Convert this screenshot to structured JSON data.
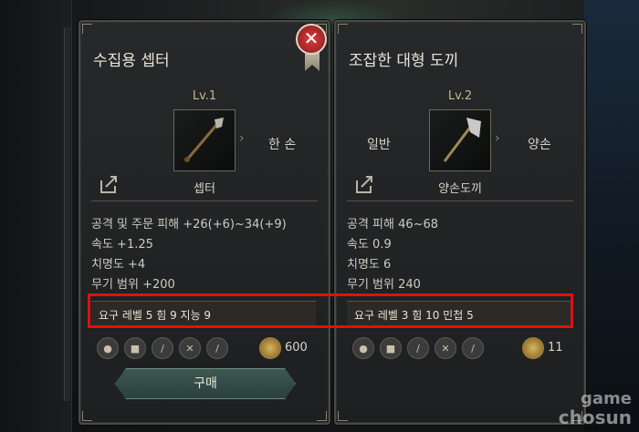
{
  "close_label": "✕",
  "items": [
    {
      "title": "수집용 셉터",
      "level": "Lv.1",
      "left_text": "",
      "right_text": "한 손",
      "weapon_type": "셉터",
      "stats": [
        "공격 및 주문 피해 +26(+6)~34(+9)",
        "속도 +1.25",
        "치명도 +4",
        "무기 범위 +200"
      ],
      "requirement": "요구 레벨 5 힘 9 지능 9",
      "price": "600",
      "buy_label": "구매"
    },
    {
      "title": "조잡한 대형 도끼",
      "level": "Lv.2",
      "left_text": "일반",
      "right_text": "양손",
      "weapon_type": "양손도끼",
      "stats": [
        "공격 피해 46~68",
        "속도 0.9",
        "치명도 6",
        "무기 범위 240"
      ],
      "requirement": "요구 레벨 3 힘 10 민첩 5",
      "price": "11"
    }
  ],
  "watermark": {
    "line1": "game",
    "line2": "chosun"
  },
  "colors": {
    "highlight": "#e01010",
    "buy_button": "#3c5852",
    "close_button": "#d84040"
  }
}
